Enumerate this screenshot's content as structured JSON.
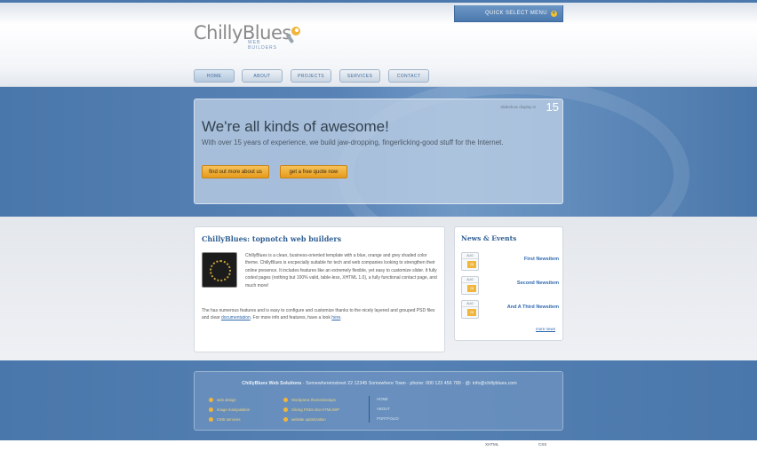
{
  "header": {
    "logo_main": "ChillyBlues",
    "logo_sub": "WEB BUILDERS",
    "quick_menu_label": "QUICK SELECT MENU"
  },
  "nav": {
    "items": [
      {
        "label": "HOME"
      },
      {
        "label": "ABOUT"
      },
      {
        "label": "PROJECTS"
      },
      {
        "label": "SERVICES"
      },
      {
        "label": "CONTACT"
      }
    ]
  },
  "hero": {
    "title": "We're all kinds of awesome!",
    "subtitle": "With over 15 years of experience, we build jaw-dropping, fingerlicking-good stuff for the Internet.",
    "slide_label": "slideshow display in",
    "slide_number": "15",
    "btn_about": "find out more about us",
    "btn_quote": "get a free quote now"
  },
  "main": {
    "title": "ChillyBlues: topnotch web builders",
    "para1": "ChillyBlues is a clean, business-oriented template with a blue, orange and grey shaded color theme. ChillyBlues is excpecially suitable for tech and web companies looking to strengthen their online presence. It includes features like an extremely flexible, yet easy to customize slider. It fully coded pages (nothing but 100% valid, table-less, XHTML 1.0), a fully functional contact page, and much more!",
    "para2_start": "The has numerous features and is easy to configure and customize thanks to the nicely layered and grouped PSD files and clear ",
    "para2_link": "documentation",
    "para2_mid": ". For more info and features, have a look ",
    "para2_link2": "here",
    "para2_end": "."
  },
  "news": {
    "title": "News & Events",
    "items": [
      {
        "month": "AUG",
        "day": "28",
        "label": "First Newsitem"
      },
      {
        "month": "AUG",
        "day": "28",
        "label": "Second Newsitem"
      },
      {
        "month": "AUG",
        "day": "28",
        "label": "And A Third Newsitem"
      }
    ],
    "more": "more news"
  },
  "footer": {
    "company": "ChillyBlues Web Solutions",
    "address": " · Somewhereinstreet 22 12345 Somewhere Town · phone: 000 123 456 789 · @: info@chillyblues.com",
    "features_col1": [
      "web design",
      "image manipulation",
      "CMS services"
    ],
    "features_col2": [
      "Wordpress themes/setups",
      "Slicing PSDs into HTML/WP",
      "website optimization"
    ],
    "links": [
      "HOME",
      "ABOUT",
      "PORTFOLIO"
    ]
  },
  "bottom": {
    "badge1": "XHTML",
    "badge2": "CSS"
  },
  "colors": {
    "brand_blue": "#4b79ad",
    "accent_orange": "#f0b53a"
  }
}
